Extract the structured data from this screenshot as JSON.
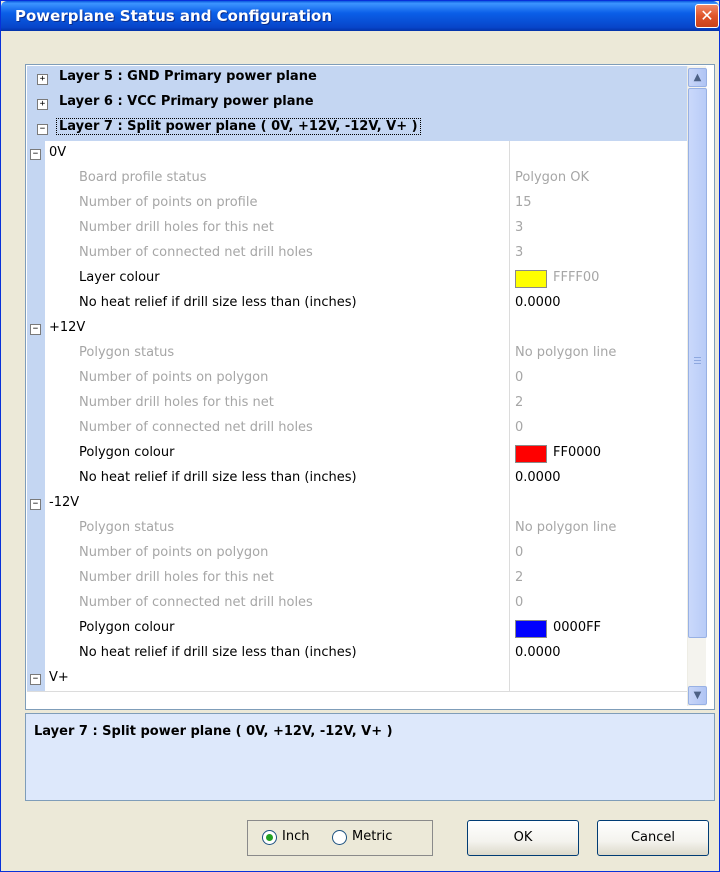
{
  "window": {
    "title": "Powerplane Status and Configuration",
    "close_glyph": "✕"
  },
  "tree": {
    "layers": [
      {
        "toggle": "+",
        "label": "Layer 5 : GND Primary power plane"
      },
      {
        "toggle": "+",
        "label": "Layer 6 : VCC Primary power plane"
      },
      {
        "toggle": "−",
        "label": "Layer 7 : Split power plane ( 0V, +12V, -12V, V+ )"
      }
    ],
    "groups": [
      {
        "name": "0V",
        "properties": [
          {
            "name": "Board profile status",
            "value": "Polygon OK"
          },
          {
            "name": "Number of points on profile",
            "value": "15"
          },
          {
            "name": "Number drill holes for this net",
            "value": "3"
          },
          {
            "name": "Number of connected net drill holes",
            "value": "3"
          },
          {
            "name": "Layer colour",
            "value": "FFFF00",
            "color": "#ffff00"
          },
          {
            "name": "No heat relief if drill size less than (inches)",
            "value": "0.0000"
          }
        ]
      },
      {
        "name": "+12V",
        "properties": [
          {
            "name": "Polygon status",
            "value": "No polygon line"
          },
          {
            "name": "Number of points on polygon",
            "value": "0"
          },
          {
            "name": "Number drill holes for this net",
            "value": "2"
          },
          {
            "name": "Number of connected net drill holes",
            "value": "0"
          },
          {
            "name": "Polygon colour",
            "value": "FF0000",
            "color": "#ff0000"
          },
          {
            "name": "No heat relief if drill size less than (inches)",
            "value": "0.0000"
          }
        ]
      },
      {
        "name": "-12V",
        "properties": [
          {
            "name": "Polygon status",
            "value": "No polygon line"
          },
          {
            "name": "Number of points on polygon",
            "value": "0"
          },
          {
            "name": "Number drill holes for this net",
            "value": "2"
          },
          {
            "name": "Number of connected net drill holes",
            "value": "0"
          },
          {
            "name": "Polygon colour",
            "value": "0000FF",
            "color": "#0000ff"
          },
          {
            "name": "No heat relief if drill size less than (inches)",
            "value": "0.0000"
          }
        ]
      },
      {
        "name": "V+",
        "properties": []
      }
    ]
  },
  "description": {
    "text": "Layer 7 : Split power plane ( 0V, +12V, -12V, V+ )"
  },
  "units": {
    "inch_label": "Inch",
    "metric_label": "Metric",
    "selected": "Inch"
  },
  "buttons": {
    "ok_label": "OK",
    "cancel_label": "Cancel"
  },
  "scrollbar": {
    "up_glyph": "▲",
    "down_glyph": "▼"
  },
  "colors": {
    "header_bg": "#c4d6f2",
    "disabled_text": "#a6a6a6"
  }
}
